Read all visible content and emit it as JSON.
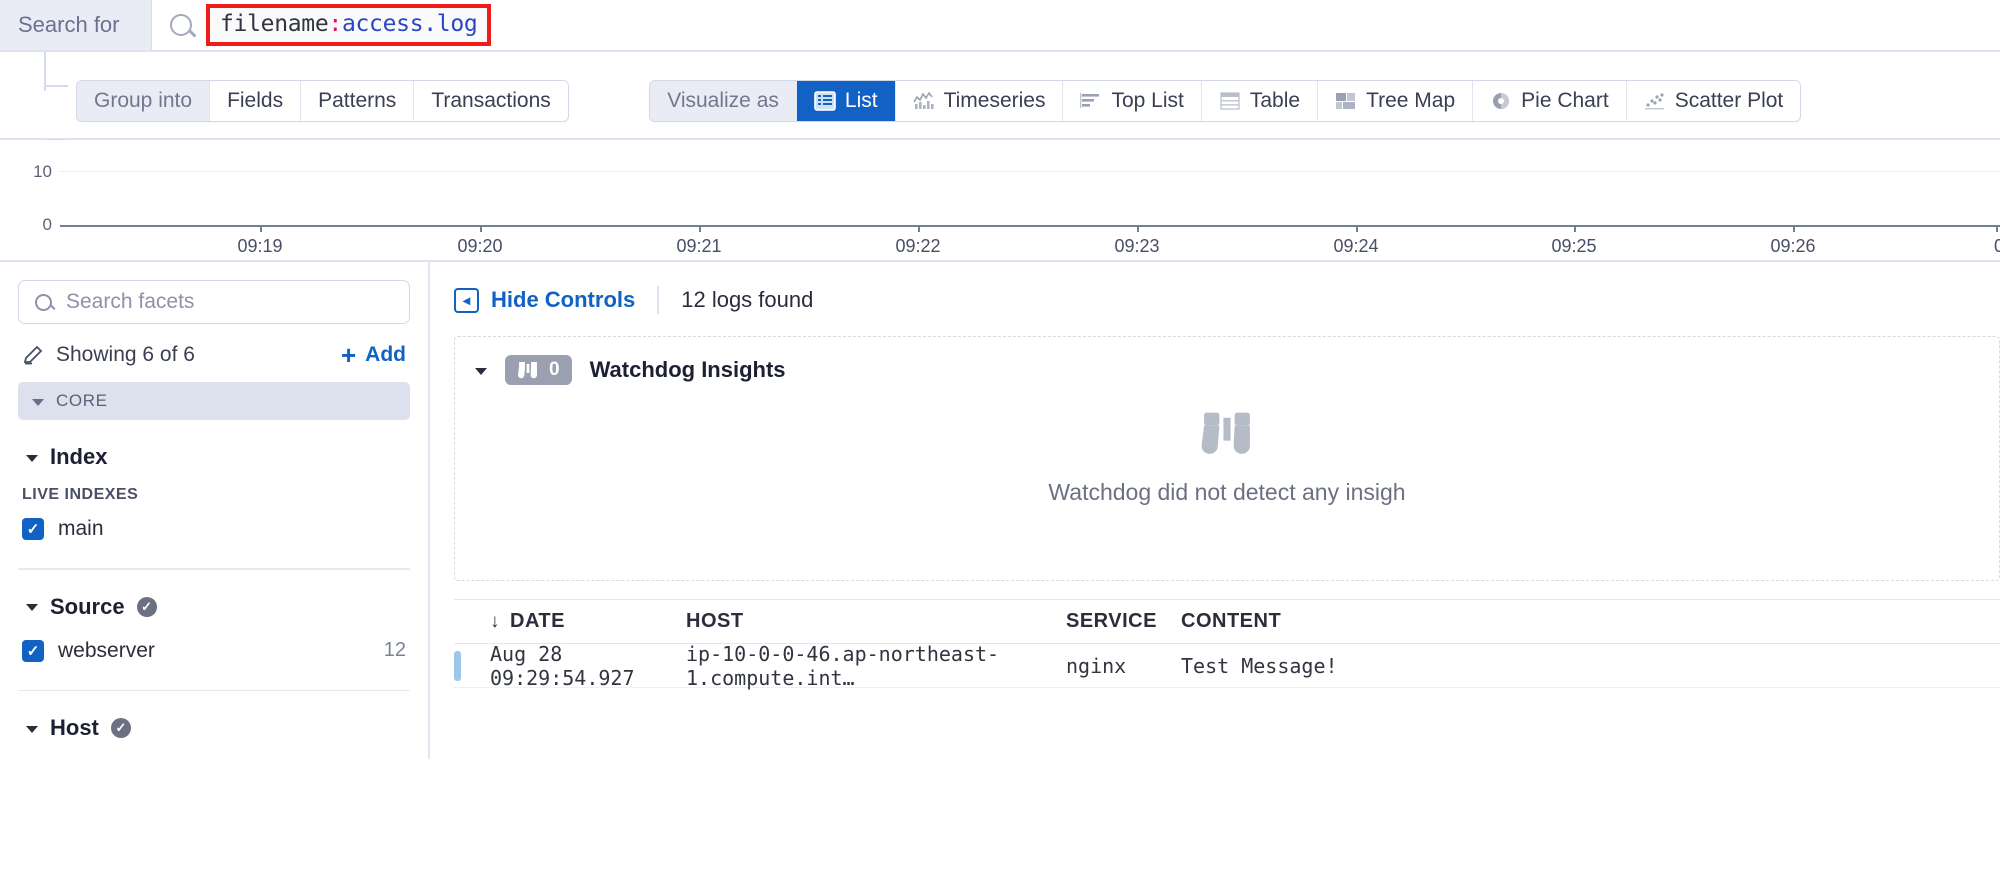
{
  "search": {
    "label": "Search for",
    "icon": "search-icon",
    "query_key": "filename",
    "query_colon": ":",
    "query_value": "access.log",
    "highlight_color": "#f01c1c"
  },
  "toolbar": {
    "group_into": {
      "label": "Group into",
      "options": [
        "Fields",
        "Patterns",
        "Transactions"
      ]
    },
    "visualize_as": {
      "label": "Visualize as",
      "selected": "List",
      "options": [
        {
          "label": "List",
          "icon": "list-icon",
          "active": true
        },
        {
          "label": "Timeseries",
          "icon": "timeseries-icon",
          "active": false
        },
        {
          "label": "Top List",
          "icon": "top-list-icon",
          "active": false
        },
        {
          "label": "Table",
          "icon": "table-icon",
          "active": false
        },
        {
          "label": "Tree Map",
          "icon": "tree-map-icon",
          "active": false
        },
        {
          "label": "Pie Chart",
          "icon": "pie-chart-icon",
          "active": false
        },
        {
          "label": "Scatter Plot",
          "icon": "scatter-plot-icon",
          "active": false
        }
      ]
    },
    "active_color": "#1162c4"
  },
  "chart_data": {
    "type": "bar",
    "title": "",
    "xlabel": "",
    "ylabel": "",
    "categories": [
      "09:19",
      "09:20",
      "09:21",
      "09:22",
      "09:23",
      "09:24",
      "09:25",
      "09:26"
    ],
    "values": [
      0,
      0,
      0,
      0,
      0,
      0,
      0,
      0
    ],
    "ytick_labels": [
      "10",
      "0"
    ],
    "ylim": [
      0,
      10
    ],
    "grid": true,
    "legend": "none"
  },
  "facets": {
    "search_placeholder": "Search facets",
    "showing": "Showing 6 of 6",
    "add_label": "Add",
    "core_label": "CORE",
    "groups": [
      {
        "title": "Index",
        "verified": false,
        "sub_label": "LIVE INDEXES",
        "items": [
          {
            "label": "main",
            "count": "",
            "checked": true
          }
        ]
      },
      {
        "title": "Source",
        "verified": true,
        "sub_label": "",
        "items": [
          {
            "label": "webserver",
            "count": "12",
            "checked": true
          }
        ]
      },
      {
        "title": "Host",
        "verified": true,
        "sub_label": "",
        "items": []
      }
    ]
  },
  "main": {
    "hide_controls": "Hide Controls",
    "logs_found": "12 logs found",
    "watchdog": {
      "title": "Watchdog Insights",
      "count": "0",
      "empty_text": "Watchdog did not detect any insigh"
    },
    "table": {
      "columns": [
        "DATE",
        "HOST",
        "SERVICE",
        "CONTENT"
      ],
      "sort_indicator": "↓",
      "rows": [
        {
          "date": "Aug 28 09:29:54.927",
          "host": "ip-10-0-0-46.ap-northeast-1.compute.int…",
          "service": "nginx",
          "content": "Test Message!"
        }
      ]
    }
  }
}
